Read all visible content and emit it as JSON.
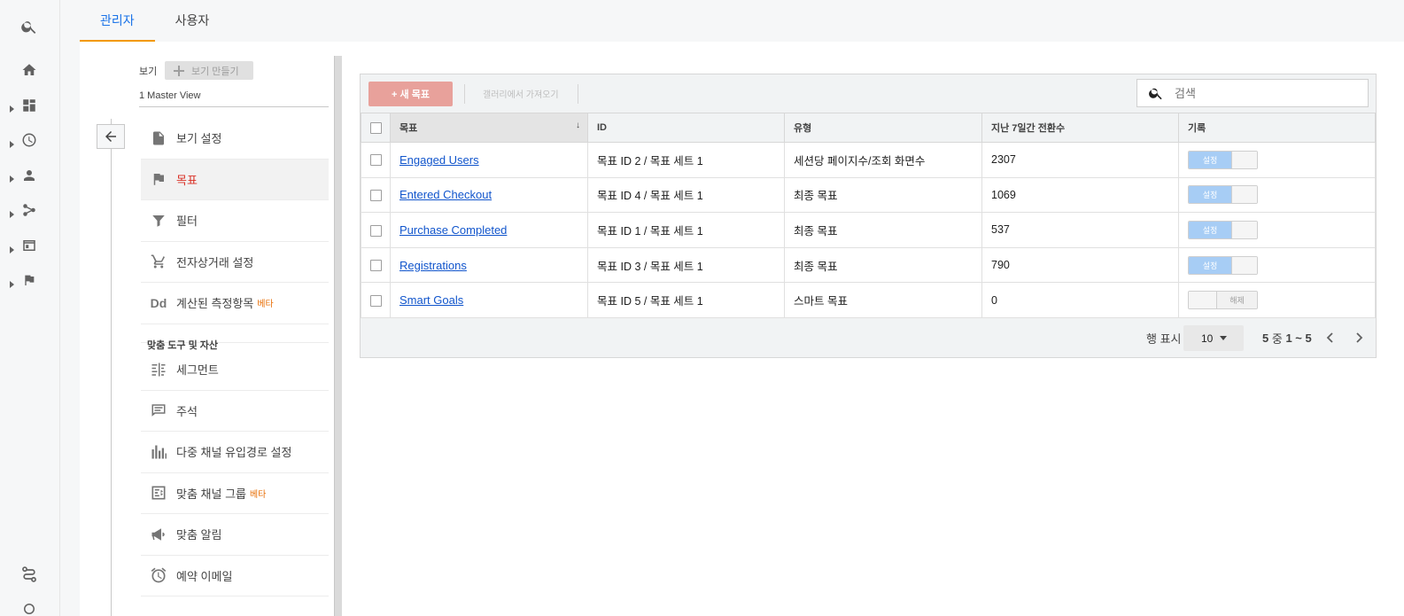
{
  "tabs": [
    {
      "label": "관리자",
      "active": true
    },
    {
      "label": "사용자",
      "active": false
    }
  ],
  "rail": {
    "icons": [
      "search-icon",
      "home-icon",
      "customization-icon",
      "realtime-icon",
      "audience-icon",
      "acquisition-icon",
      "behavior-icon",
      "conversions-icon",
      "attribution-icon",
      "discover-icon"
    ]
  },
  "view": {
    "label": "보기",
    "create_label": "보기 만들기",
    "current": "1 Master View"
  },
  "menu": {
    "items": [
      {
        "label": "보기 설정",
        "icon": "document-icon"
      },
      {
        "label": "목표",
        "icon": "flag-icon",
        "active": true
      },
      {
        "label": "필터",
        "icon": "filter-icon"
      },
      {
        "label": "전자상거래 설정",
        "icon": "cart-icon"
      },
      {
        "label": "계산된 측정항목",
        "icon": "dd-icon",
        "badge": "베타"
      }
    ],
    "section_title": "맞춤 도구 및 자산",
    "tools": [
      {
        "label": "세그먼트",
        "icon": "segments-icon"
      },
      {
        "label": "주석",
        "icon": "annotation-icon"
      },
      {
        "label": "다중 채널 유입경로 설정",
        "icon": "bar-chart-icon"
      },
      {
        "label": "맞춤 채널 그룹",
        "icon": "channel-group-icon",
        "badge": "베타"
      },
      {
        "label": "맞춤 알림",
        "icon": "megaphone-icon"
      },
      {
        "label": "예약 이메일",
        "icon": "alarm-clock-icon"
      }
    ]
  },
  "toolbar": {
    "new_goal": "+ 새 목표",
    "import_gallery": "갤러리에서 가져오기",
    "search_placeholder": "검색"
  },
  "table": {
    "columns": [
      "목표",
      "ID",
      "유형",
      "지난 7일간 전환수",
      "기록"
    ],
    "rows": [
      {
        "goal": "Engaged Users",
        "id": "목표 ID 2 / 목표 세트 1",
        "type": "세션당 페이지수/조회 화면수",
        "conversions": "2307",
        "record": "설정",
        "on": true
      },
      {
        "goal": "Entered Checkout",
        "id": "목표 ID 4 / 목표 세트 1",
        "type": "최종 목표",
        "conversions": "1069",
        "record": "설정",
        "on": true
      },
      {
        "goal": "Purchase Completed",
        "id": "목표 ID 1 / 목표 세트 1",
        "type": "최종 목표",
        "conversions": "537",
        "record": "설정",
        "on": true
      },
      {
        "goal": "Registrations",
        "id": "목표 ID 3 / 목표 세트 1",
        "type": "최종 목표",
        "conversions": "790",
        "record": "설정",
        "on": true
      },
      {
        "goal": "Smart Goals",
        "id": "목표 ID 5 / 목표 세트 1",
        "type": "스마트 목표",
        "conversions": "0",
        "record": "해제",
        "on": false
      }
    ]
  },
  "pager": {
    "rows_label": "행 표시",
    "rows_value": "10",
    "range_total": "5",
    "range_mid": "중",
    "range_span": "1 ~ 5"
  },
  "colors": {
    "accent": "#1a73e8",
    "tab_underline": "#f29900",
    "active_menu": "#d93025",
    "new_goal_bg": "#e8a19b",
    "toggle_on": "#a7cdf5",
    "link": "#1155cc"
  }
}
